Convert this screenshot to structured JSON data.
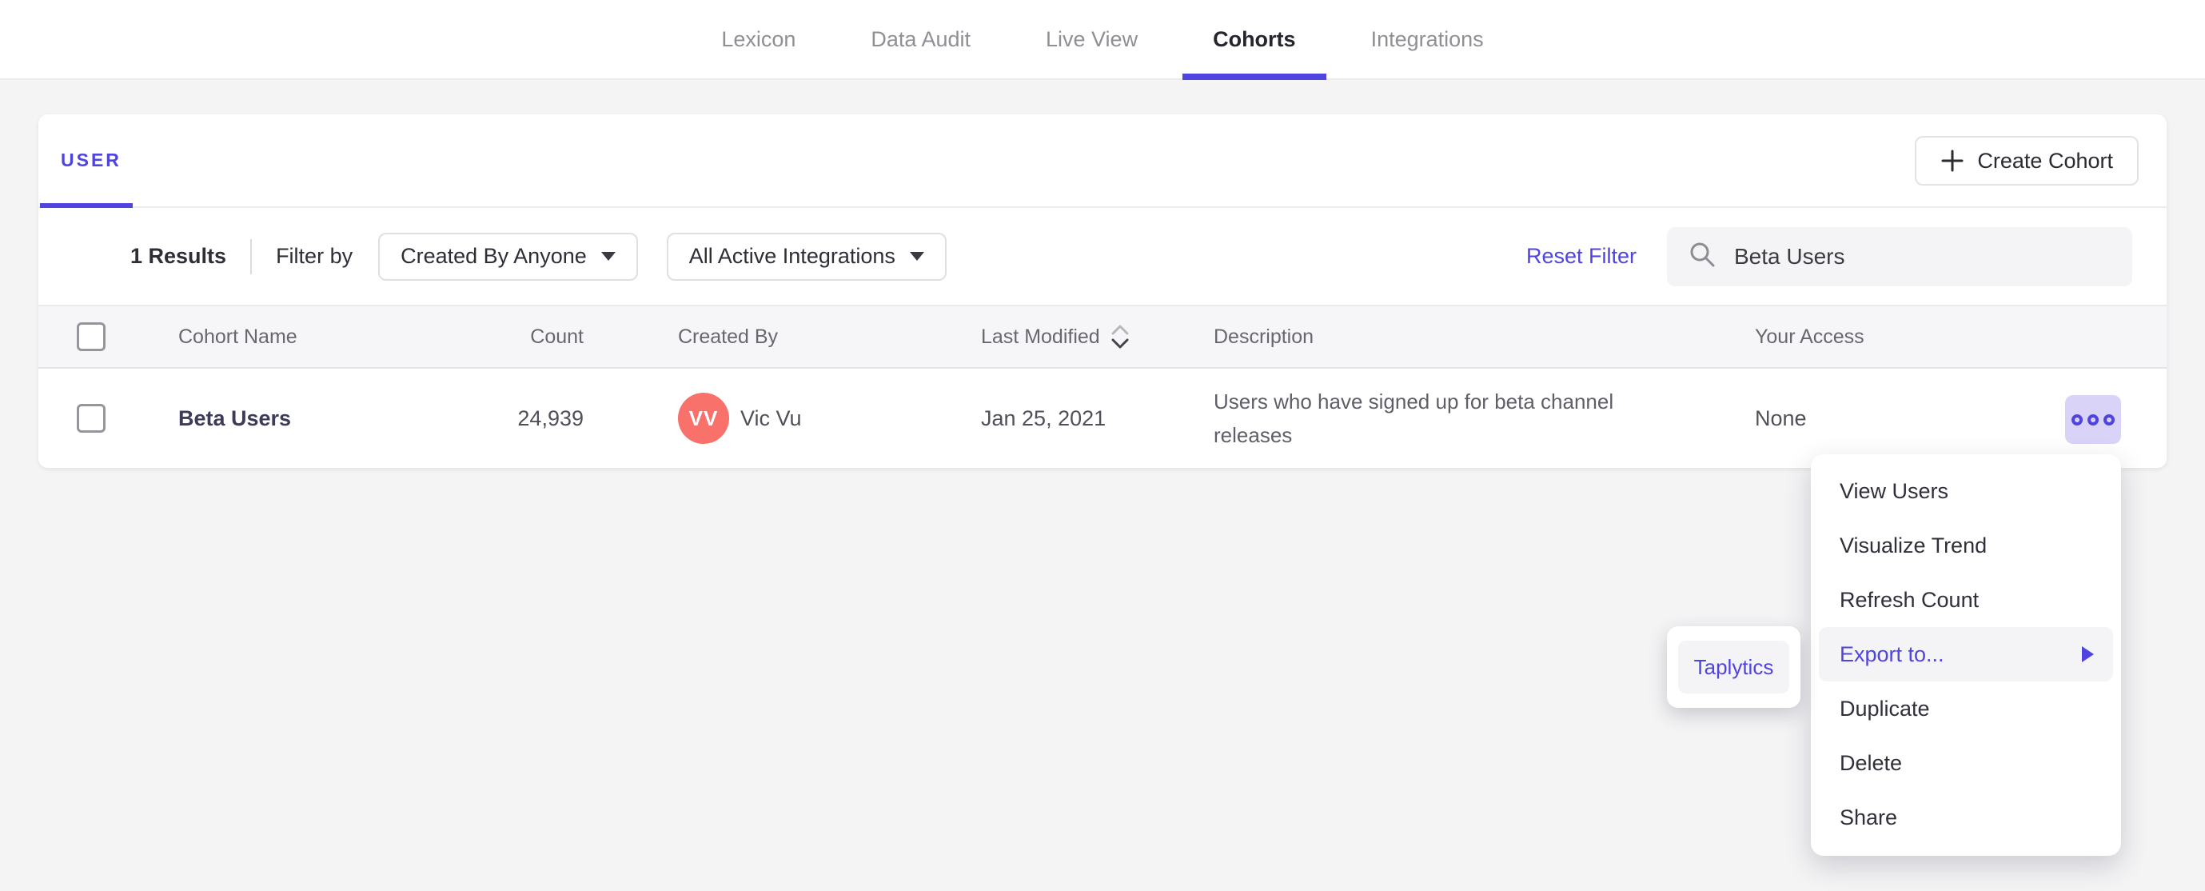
{
  "nav": {
    "active_tab": "Cohorts",
    "tabs": [
      {
        "label": "Lexicon"
      },
      {
        "label": "Data Audit"
      },
      {
        "label": "Live View"
      },
      {
        "label": "Cohorts"
      },
      {
        "label": "Integrations"
      }
    ]
  },
  "card": {
    "type_tab": "USER",
    "create_button_label": "Create Cohort",
    "filter_bar": {
      "results": "1 Results",
      "filter_by_label": "Filter by",
      "created_by_dropdown": "Created By Anyone",
      "integrations_dropdown": "All Active Integrations",
      "reset_filter_label": "Reset Filter",
      "search_value": "Beta Users"
    },
    "table": {
      "headers": {
        "name": "Cohort Name",
        "count": "Count",
        "created_by": "Created By",
        "last_modified": "Last Modified",
        "description": "Description",
        "access": "Your Access"
      },
      "rows": [
        {
          "name": "Beta Users",
          "count": "24,939",
          "creator_initials": "VV",
          "creator_name": "Vic Vu",
          "last_modified": "Jan 25, 2021",
          "description": "Users who have signed up for beta channel releases",
          "access": "None"
        }
      ]
    }
  },
  "context_menu": {
    "items": [
      {
        "label": "View Users"
      },
      {
        "label": "Visualize Trend"
      },
      {
        "label": "Refresh Count"
      },
      {
        "label": "Export to...",
        "highlighted": true,
        "has_submenu": true
      },
      {
        "label": "Duplicate"
      },
      {
        "label": "Delete"
      },
      {
        "label": "Share"
      }
    ],
    "submenu": {
      "items": [
        {
          "label": "Taplytics"
        }
      ]
    }
  },
  "icons": {
    "more_options": "three-dots",
    "search": "magnifier",
    "sort": "up-down-chevrons",
    "plus": "plus",
    "caret": "caret-down",
    "submenu_arrow": "triangle-right"
  },
  "colors": {
    "accent": "#4f44e0",
    "accent_light_bg": "#d9d3f7",
    "avatar_bg": "#f8716a",
    "page_bg": "#f4f4f5",
    "table_header_bg": "#f6f6f8",
    "menu_highlight_bg": "#f4f4f6"
  }
}
